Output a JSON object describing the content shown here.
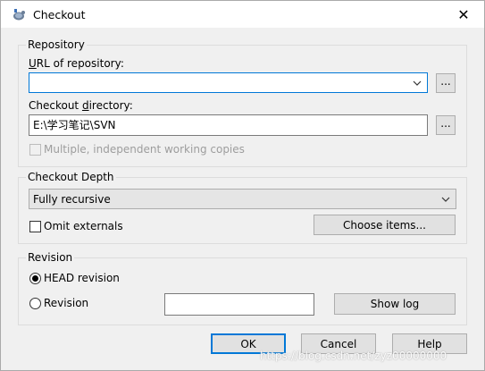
{
  "window": {
    "title": "Checkout",
    "close_glyph": "✕"
  },
  "repository": {
    "legend": "Repository",
    "url_label": "URL of repository:",
    "url_value": "",
    "url_browse": "...",
    "dir_label": "Checkout directory:",
    "dir_value": "E:\\学习笔记\\SVN",
    "dir_browse": "...",
    "multiple_label": "Multiple, independent working copies",
    "multiple_checked": false
  },
  "depth": {
    "legend": "Checkout Depth",
    "selected": "Fully recursive",
    "omit_externals_label": "Omit externals",
    "omit_externals_checked": false,
    "choose_items": "Choose items..."
  },
  "revision": {
    "legend": "Revision",
    "head_label": "HEAD revision",
    "head_selected": true,
    "revision_label": "Revision",
    "revision_value": "",
    "show_log": "Show log"
  },
  "buttons": {
    "ok": "OK",
    "cancel": "Cancel",
    "help": "Help"
  },
  "watermark": "https://blog.csdn.net/zyz00000000",
  "colors": {
    "focus_border": "#0078d7",
    "background": "#f0f0f0"
  }
}
